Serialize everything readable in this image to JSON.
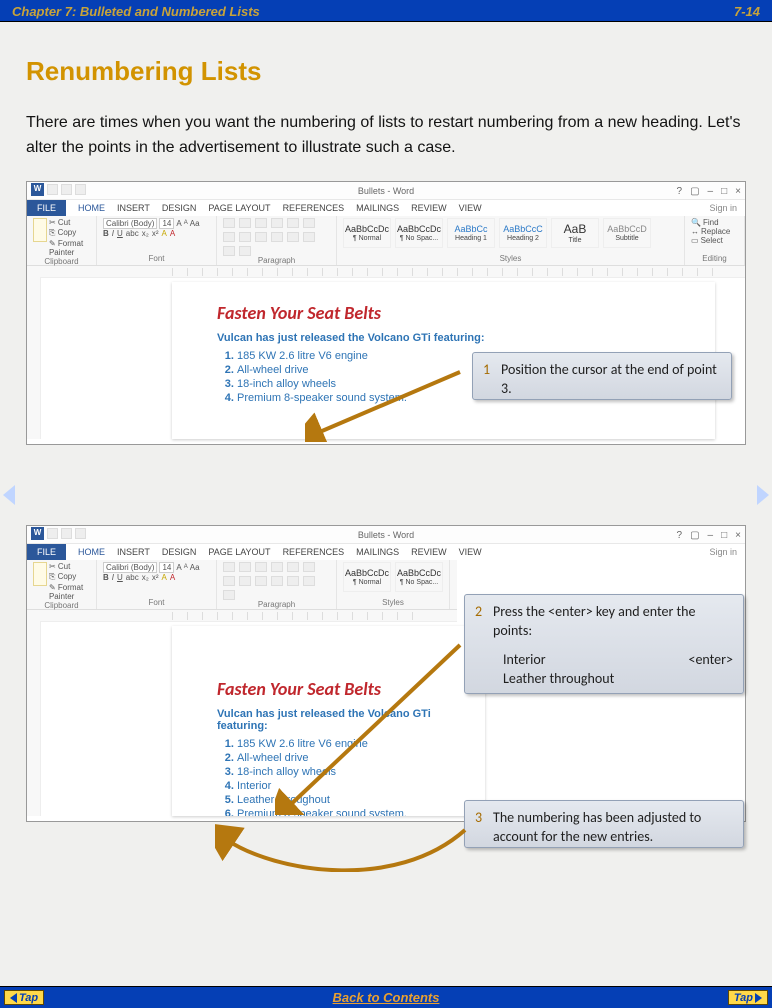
{
  "header": {
    "chapter": "Chapter 7:  Bulleted and Numbered Lists",
    "page": "7-14"
  },
  "title": "Renumbering Lists",
  "intro": "There are times when you want the numbering of lists to restart numbering from a new heading.  Let's alter the points in the advertisement to illustrate such a case.",
  "word": {
    "title": "Bullets - Word",
    "sign_in": "Sign in",
    "tabs": {
      "file": "FILE",
      "home": "HOME",
      "insert": "INSERT",
      "design": "DESIGN",
      "layout": "PAGE LAYOUT",
      "references": "REFERENCES",
      "mailings": "MAILINGS",
      "review": "REVIEW",
      "view": "VIEW"
    },
    "groups": {
      "clipboard": {
        "label": "Clipboard",
        "paste": "Paste",
        "cut": "Cut",
        "copy": "Copy",
        "fp": "Format Painter"
      },
      "font": {
        "label": "Font",
        "family": "Calibri (Body)",
        "size": "14"
      },
      "paragraph": {
        "label": "Paragraph"
      },
      "styles": {
        "label": "Styles",
        "items": [
          "AaBbCcDc",
          "AaBbCcDc",
          "AaBbCc",
          "AaBbCcC",
          "AaB",
          "AaBbCcD"
        ],
        "names": [
          "¶ Normal",
          "¶ No Spac...",
          "Heading 1",
          "Heading 2",
          "Title",
          "Subtitle"
        ]
      },
      "editing": {
        "label": "Editing",
        "find": "Find",
        "replace": "Replace",
        "select": "Select"
      }
    }
  },
  "doc": {
    "heading": "Fasten Your Seat Belts",
    "sub": "Vulcan has just released the Volcano GTi featuring:",
    "list1": [
      "185 KW 2.6 litre V6 engine",
      "All-wheel drive",
      "18-inch alloy wheels",
      "Premium 8-speaker sound system."
    ],
    "list2": [
      "185 KW 2.6 litre V6 engine",
      "All-wheel drive",
      "18-inch alloy wheels",
      "Interior",
      "Leather throughout",
      "Premium 8-speaker sound system."
    ]
  },
  "callouts": {
    "c1": {
      "n": "1",
      "text": "Position the cursor at the end of point 3."
    },
    "c2": {
      "n": "2",
      "text": "Press the <enter> key and enter the points:",
      "entries": [
        {
          "l": "Interior",
          "r": "<enter>"
        },
        {
          "l": "Leather throughout",
          "r": ""
        }
      ]
    },
    "c3": {
      "n": "3",
      "text": "The numbering has been adjusted to account for the new entries."
    }
  },
  "footer": {
    "tap": "Tap",
    "back": "Back to Contents"
  }
}
